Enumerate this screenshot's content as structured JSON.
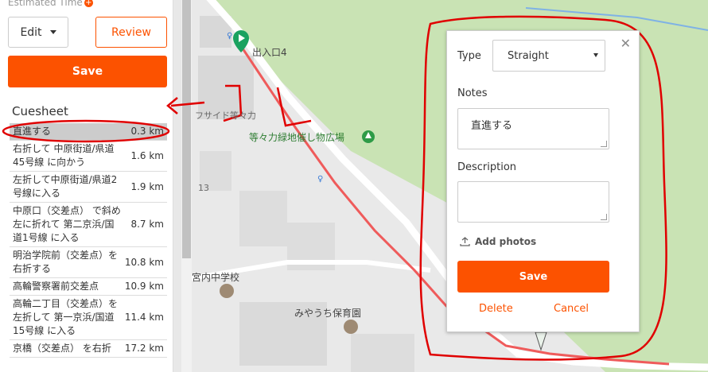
{
  "sidebar": {
    "estimated_time_label": "Estimated Time",
    "edit_label": "Edit",
    "review_label": "Review",
    "save_label": "Save",
    "cuesheet_title": "Cuesheet",
    "cues": [
      {
        "text": "直進する",
        "dist": "0.3 km",
        "selected": true
      },
      {
        "text": "右折して 中原街道/県道45号線 に向かう",
        "dist": "1.6 km"
      },
      {
        "text": "左折して中原街道/県道2号線に入る",
        "dist": "1.9 km"
      },
      {
        "text": "中原口（交差点） で斜め左に折れて 第二京浜/国道1号線 に入る",
        "dist": "8.7 km"
      },
      {
        "text": "明治学院前（交差点）を右折する",
        "dist": "10.8 km"
      },
      {
        "text": "高輪警察署前交差点",
        "dist": "10.9 km"
      },
      {
        "text": "高輪二丁目（交差点）を左折して 第一京浜/国道15号線 に入る",
        "dist": "11.4 km"
      },
      {
        "text": "京橋（交差点） を右折",
        "dist": "17.2 km"
      }
    ]
  },
  "map": {
    "labels": {
      "entrance": "出入口4",
      "plaza": "等々力緑地催し物広場",
      "building": "フサイド等々力",
      "block": "13",
      "school": "宮内中学校",
      "nursery": "みやうち保育園"
    }
  },
  "popup": {
    "type_label": "Type",
    "type_value": "Straight",
    "notes_label": "Notes",
    "notes_value": "直進する",
    "description_label": "Description",
    "description_value": "",
    "add_photos_label": "Add photos",
    "save_label": "Save",
    "delete_label": "Delete",
    "cancel_label": "Cancel"
  },
  "colors": {
    "accent": "#fc5200",
    "route": "#ef5b5b",
    "annotation": "#e00000",
    "park": "#c9e3b4"
  }
}
